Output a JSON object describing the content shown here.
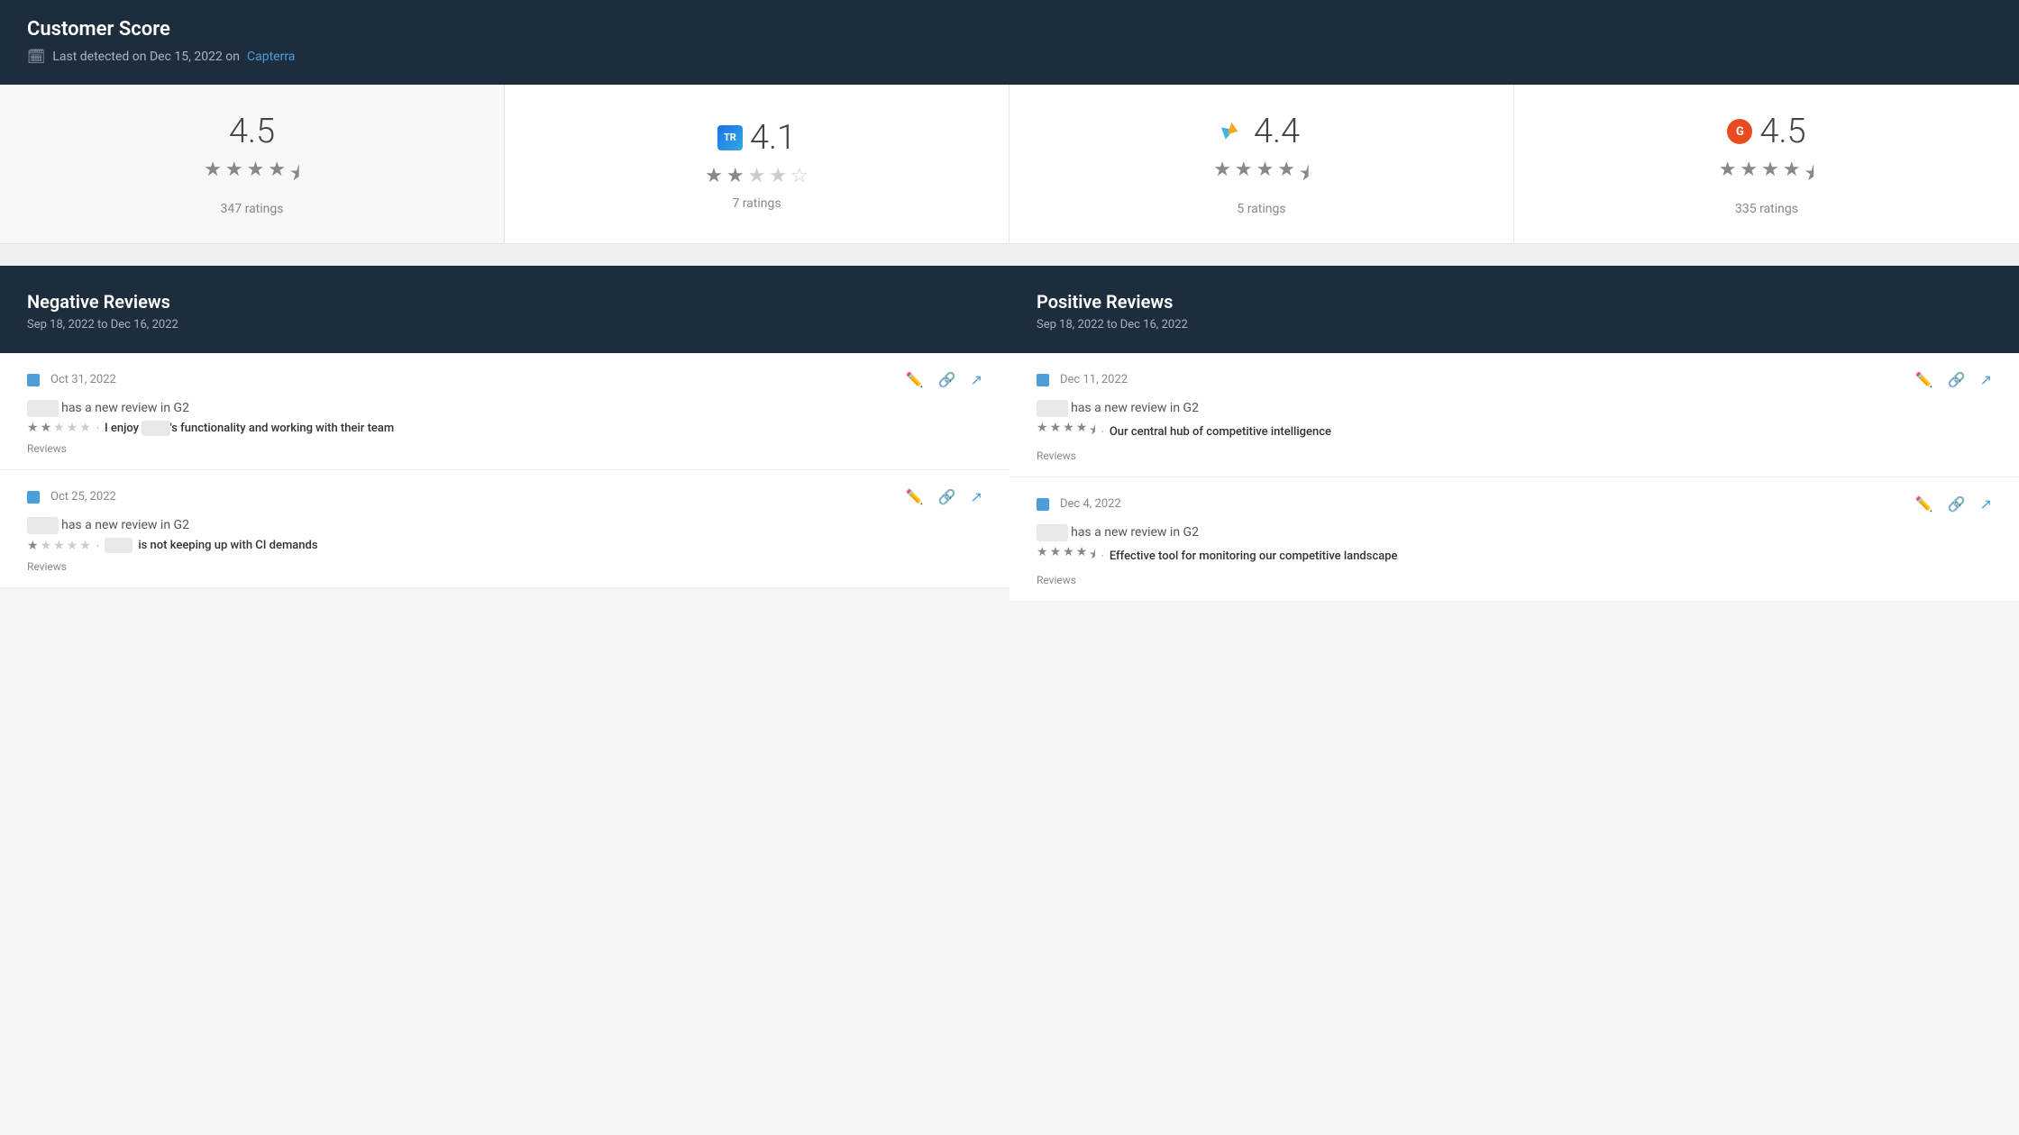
{
  "header": {
    "title": "Customer Score",
    "subtitle_prefix": "Last detected on Dec 15, 2022 on",
    "subtitle_link_text": "Capterra",
    "calendar_icon": "📅"
  },
  "ratings": [
    {
      "score": "4.5",
      "platform": "aggregate",
      "platform_logo": null,
      "stars": [
        1,
        1,
        1,
        1,
        0.5
      ],
      "count": "347 ratings"
    },
    {
      "score": "4.1",
      "platform": "TrustRadius",
      "platform_logo": "TR",
      "stars": [
        1,
        1,
        0,
        0,
        0
      ],
      "count": "7 ratings"
    },
    {
      "score": "4.4",
      "platform": "Capterra",
      "platform_logo": "capterra",
      "stars": [
        1,
        1,
        1,
        1,
        0.5
      ],
      "count": "5 ratings"
    },
    {
      "score": "4.5",
      "platform": "G2",
      "platform_logo": "G2",
      "stars": [
        1,
        1,
        1,
        1,
        0.5
      ],
      "count": "335 ratings"
    }
  ],
  "negative_reviews": {
    "title": "Negative Reviews",
    "date_range": "Sep 18, 2022 to Dec 16, 2022",
    "items": [
      {
        "date": "Oct 31, 2022",
        "company_text": "has a new review in G2",
        "rating_stars": [
          1,
          1,
          0,
          0,
          0
        ],
        "review_title": "I enjoy",
        "review_title_suffix": "'s functionality and working with their team",
        "tag": "Reviews"
      },
      {
        "date": "Oct 25, 2022",
        "company_text": "has a new review in G2",
        "rating_stars": [
          1,
          0,
          0,
          0,
          0
        ],
        "review_title": "",
        "review_title_suffix": "is not keeping up with CI demands",
        "tag": "Reviews"
      }
    ]
  },
  "positive_reviews": {
    "title": "Positive Reviews",
    "date_range": "Sep 18, 2022 to Dec 16, 2022",
    "items": [
      {
        "date": "Dec 11, 2022",
        "company_text": "has a new review in G2",
        "rating_stars": [
          1,
          1,
          1,
          1,
          0.5
        ],
        "review_title": "Our central hub of competitive intelligence",
        "tag": "Reviews"
      },
      {
        "date": "Dec 4, 2022",
        "company_text": "has a new review in G2",
        "rating_stars": [
          1,
          1,
          1,
          1,
          0.5
        ],
        "review_title": "Effective tool for monitoring our competitive landscape",
        "tag": "Reviews"
      }
    ]
  },
  "icons": {
    "edit": "✏️",
    "link": "🔗",
    "external": "↗"
  }
}
